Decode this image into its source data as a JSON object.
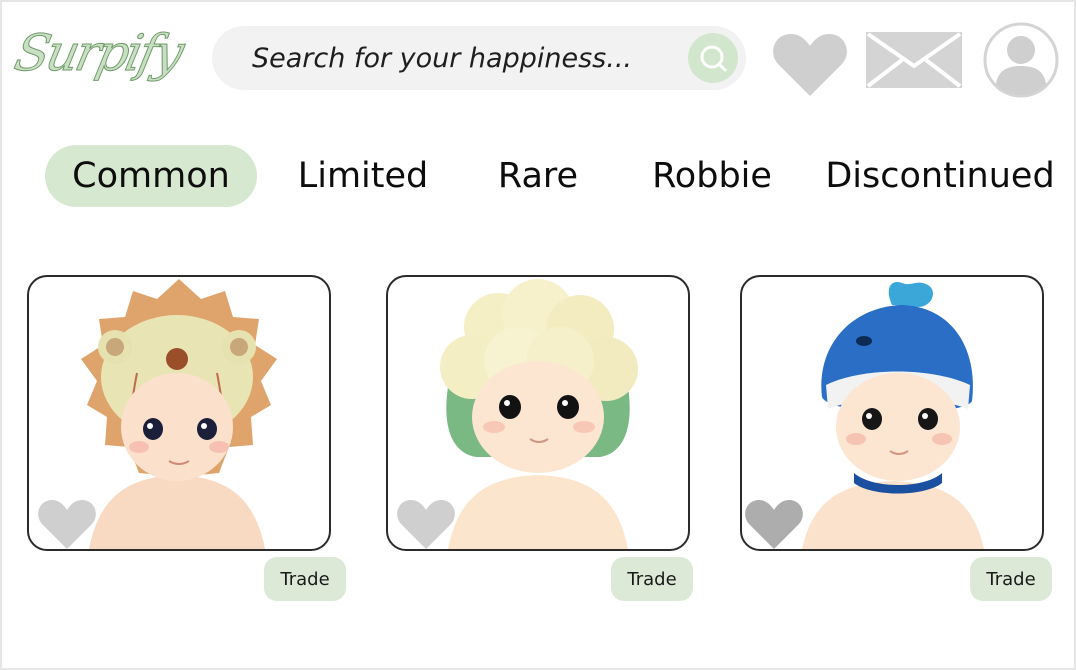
{
  "brand": {
    "logo_text": "Surpify"
  },
  "search": {
    "placeholder": "Search for your happiness..."
  },
  "header_icons": [
    "heart-icon",
    "mail-icon",
    "profile-icon"
  ],
  "tabs": [
    {
      "label": "Common",
      "active": true
    },
    {
      "label": "Limited",
      "active": false
    },
    {
      "label": "Rare",
      "active": false
    },
    {
      "label": "Robbie",
      "active": false
    },
    {
      "label": "Discontinued",
      "active": false
    }
  ],
  "cards": [
    {
      "figure": "lion-hat-figure",
      "action_label": "Trade",
      "favorited": false
    },
    {
      "figure": "cauliflower-hat-figure",
      "action_label": "Trade",
      "favorited": false
    },
    {
      "figure": "whale-hat-figure",
      "action_label": "Trade",
      "favorited": false
    }
  ],
  "colors": {
    "accent": "#d6e8d0",
    "icon_gray": "#d0d0d0",
    "card_border": "#2b2b2b"
  }
}
